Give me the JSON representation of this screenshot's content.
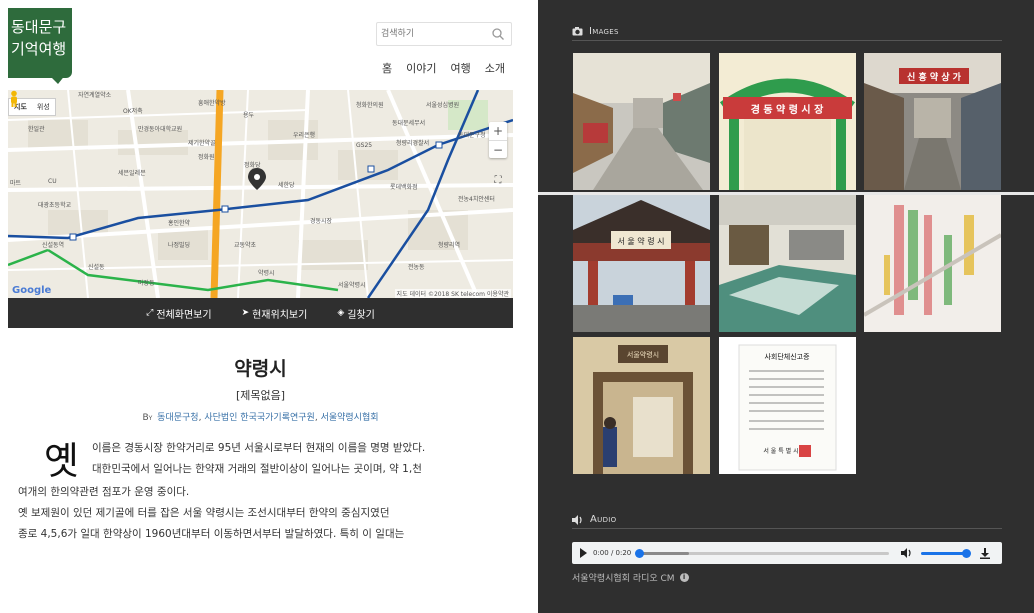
{
  "site": {
    "logo_text": "동대문구\n기억여행",
    "search_placeholder": "검색하기",
    "nav": [
      "홈",
      "이야기",
      "여행",
      "소개"
    ]
  },
  "map": {
    "tabs": [
      "지도",
      "위성"
    ],
    "zoom_in": "+",
    "zoom_out": "−",
    "google": "Google",
    "copyright": "지도 데이터 ©2018 SK telecom  이용약관",
    "labels": [
      "자연계열약소",
      "OK저축",
      "흥애한약방",
      "청화한의원",
      "서울성심병원",
      "한일관",
      "만경동아대학교원",
      "동대문세무서",
      "용두",
      "우리은행",
      "제기한약골",
      "GS25",
      "청량리경찰서",
      "동대문구청",
      "정화원",
      "정화당",
      "세한당",
      "마트",
      "CU",
      "세븐일레븐",
      "롯데백화점",
      "전농4치안센터",
      "대광초등학교",
      "홍인한약",
      "경동시장",
      "교동약초",
      "신설동역",
      "나정빌딩",
      "청량리역",
      "약령시",
      "전농동",
      "신설동",
      "서울약령시",
      "마장동"
    ],
    "controls": {
      "full": "전체화면보기",
      "location": "현재위치보기",
      "directions": "길찾기"
    }
  },
  "article": {
    "title": "약령시",
    "subtitle": "[제목없음]",
    "by_label": "By",
    "authors": [
      "동대문구청",
      "사단법인 한국국가기록연구원",
      "서울약령시협회"
    ],
    "dropcap": "옛",
    "lines": [
      "이름은 경동시장 한약거리로 95년 서울시로부터 현재의 이름을 명명 받았다.",
      "대한민국에서 일어나는 한약재 거래의 절반이상이 일어나는 곳이며, 약 1,천",
      "여개의 한의약관련 점포가 운영 중이다.",
      "옛 보제원이 있던 제기골에 터를 잡은 서울 약령시는 조선시대부터 한약의 중심지였던",
      "종로 4,5,6가 일대 한약상이 1960년대부터 이동하면서부터 발달하였다. 특히 이 일대는"
    ]
  },
  "images_section": {
    "title": "Images",
    "thumbs": [
      {
        "name": "street-market-photo",
        "sign": ""
      },
      {
        "name": "gate-sign-photo",
        "sign": "경 동 약 령 시 장"
      },
      {
        "name": "shopping-street-photo",
        "sign": "신 흥 약 상 가"
      },
      {
        "name": "traditional-gate-photo",
        "sign": "서 울 약 령 시"
      },
      {
        "name": "office-interior-photo",
        "sign": ""
      },
      {
        "name": "street-map-photo",
        "sign": ""
      },
      {
        "name": "museum-doorway-photo",
        "sign": "서울약령시"
      },
      {
        "name": "document-photo",
        "sign": "사회단체신고증"
      }
    ],
    "document_footer": "서 울 특 별 시"
  },
  "audio_section": {
    "title": "Audio",
    "time": "0:00 / 0:20",
    "progress": 0,
    "volume": 1,
    "caption": "서울약령시협회 라디오 CM"
  },
  "colors": {
    "logo": "#2e6b3c",
    "dark_panel": "#2f2f2f",
    "link": "#3a72a8",
    "audio_accent": "#1a73e8"
  }
}
